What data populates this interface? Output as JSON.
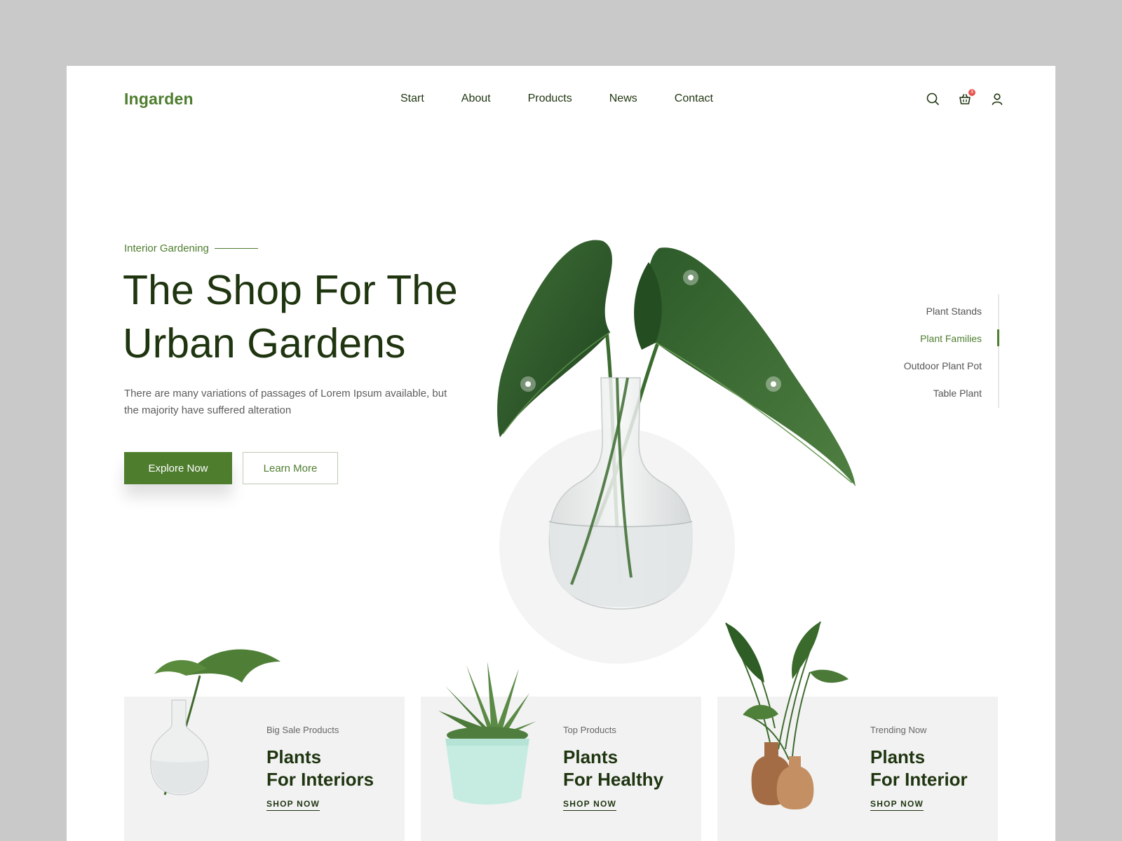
{
  "brand": {
    "logo": "Ingarden",
    "accent": "#4e7d2e",
    "text_dark": "#1f3510"
  },
  "nav": [
    "Start",
    "About",
    "Products",
    "News",
    "Contact"
  ],
  "header_icons": {
    "search": "search-icon",
    "cart": "basket-icon",
    "cart_badge": "3",
    "user": "user-icon"
  },
  "hero": {
    "eyebrow": "Interior Gardening",
    "title_line1": "The Shop For The",
    "title_line2": "Urban Gardens",
    "description": "There are many variations of passages of Lorem Ipsum available, but the majority have suffered alteration",
    "primary_button": "Explore Now",
    "secondary_button": "Learn More"
  },
  "categories": [
    {
      "label": "Plant Stands",
      "active": false
    },
    {
      "label": "Plant Families",
      "active": true
    },
    {
      "label": "Outdoor Plant Pot",
      "active": false
    },
    {
      "label": "Table Plant",
      "active": false
    }
  ],
  "cards": [
    {
      "subtitle": "Big Sale Products",
      "title_line1": "Plants",
      "title_line2": "For Interiors",
      "link": "SHOP NOW"
    },
    {
      "subtitle": "Top Products",
      "title_line1": "Plants",
      "title_line2": "For Healthy",
      "link": "SHOP NOW"
    },
    {
      "subtitle": "Trending Now",
      "title_line1": "Plants",
      "title_line2": "For Interior",
      "link": "SHOP NOW"
    }
  ]
}
